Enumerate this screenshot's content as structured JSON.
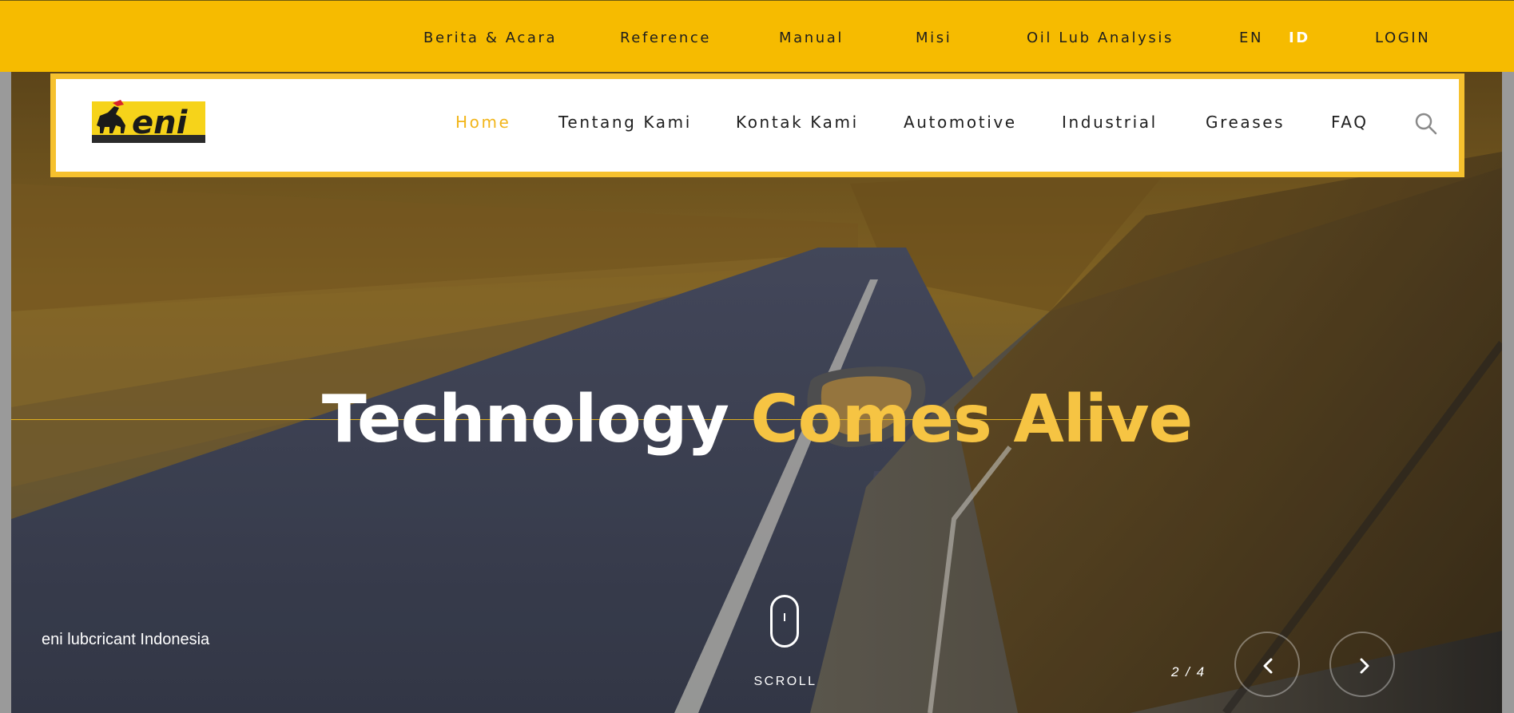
{
  "topbar": {
    "items": [
      "Berita & Acara",
      "Reference",
      "Manual",
      "Misi",
      "Oil Lub Analysis"
    ],
    "lang_en": "EN",
    "lang_id": "ID",
    "login": "LOGIN"
  },
  "nav": {
    "items": [
      "Home",
      "Tentang Kami",
      "Kontak Kami",
      "Automotive",
      "Industrial",
      "Greases",
      "FAQ"
    ],
    "active_index": 0
  },
  "logo": {
    "text": "eni"
  },
  "hero": {
    "headline_white": "Technology",
    "headline_yellow": "Comes Alive",
    "tagline": "eni lubcricant Indonesia",
    "scroll_label": "SCROLL",
    "slide_counter": "2 / 4"
  },
  "colors": {
    "brand_yellow": "#f6bb00",
    "accent_yellow": "#f6c443",
    "nav_active": "#f2b51a",
    "dark_text": "#1e1e1e"
  },
  "icons": {
    "search": "search-icon",
    "prev": "chevron-left-icon",
    "next": "chevron-right-icon",
    "scroll": "mouse-icon"
  }
}
